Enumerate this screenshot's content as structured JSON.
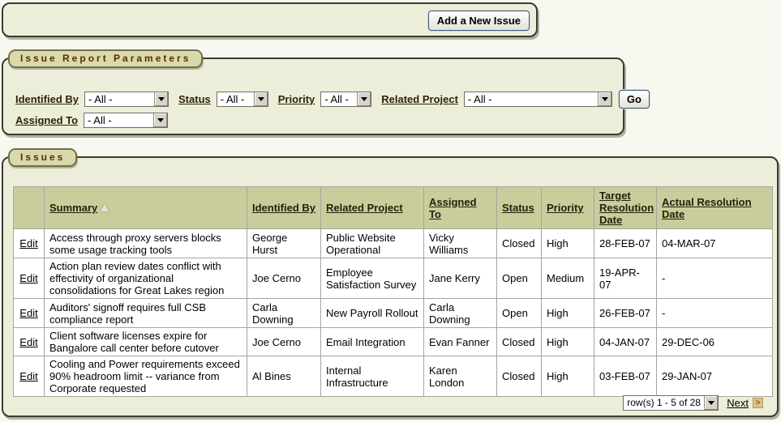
{
  "colors": {
    "page_bg": "#f7f9f0",
    "region_bg": "#edeeda",
    "tab_bg": "#d9d9ab",
    "tab_text": "#5a2c04",
    "table_header_bg": "#cacc9c",
    "button_border": "#3c5a7d",
    "next_icon_bg": "#dcc188"
  },
  "toolbar": {
    "add_button": "Add a New Issue"
  },
  "parameters": {
    "title": "Issue Report Parameters",
    "fields": [
      {
        "label": "Identified By",
        "value": "- All -"
      },
      {
        "label": "Status",
        "value": "- All -"
      },
      {
        "label": "Priority",
        "value": "- All -"
      },
      {
        "label": "Related Project",
        "value": "- All -"
      },
      {
        "label": "Assigned To",
        "value": "- All -"
      }
    ],
    "go_button": "Go"
  },
  "issues": {
    "title": "Issues",
    "edit_label": "Edit",
    "columns": [
      "",
      "Summary",
      "Identified By",
      "Related Project",
      "Assigned To",
      "Status",
      "Priority",
      "Target Resolution Date",
      "Actual Resolution Date"
    ],
    "sorted_column": "Summary",
    "sort_direction": "asc",
    "rows": [
      {
        "summary": "Access through proxy servers blocks some usage tracking tools",
        "identified_by": "George Hurst",
        "related_project": "Public Website Operational",
        "assigned_to": "Vicky Williams",
        "status": "Closed",
        "priority": "High",
        "target": "28-FEB-07",
        "actual": "04-MAR-07"
      },
      {
        "summary": "Action plan review dates conflict with effectivity of organizational consolidations for Great Lakes region",
        "identified_by": "Joe Cerno",
        "related_project": "Employee Satisfaction Survey",
        "assigned_to": "Jane Kerry",
        "status": "Open",
        "priority": "Medium",
        "target": "19-APR-07",
        "actual": "-"
      },
      {
        "summary": "Auditors' signoff requires full CSB compliance report",
        "identified_by": "Carla Downing",
        "related_project": "New Payroll Rollout",
        "assigned_to": "Carla Downing",
        "status": "Open",
        "priority": "High",
        "target": "26-FEB-07",
        "actual": "-"
      },
      {
        "summary": "Client software licenses expire for Bangalore call center before cutover",
        "identified_by": "Joe Cerno",
        "related_project": "Email Integration",
        "assigned_to": "Evan Fanner",
        "status": "Closed",
        "priority": "High",
        "target": "04-JAN-07",
        "actual": "29-DEC-06"
      },
      {
        "summary": "Cooling and Power requirements exceed 90% headroom limit -- variance from Corporate requested",
        "identified_by": "Al Bines",
        "related_project": "Internal Infrastructure",
        "assigned_to": "Karen London",
        "status": "Closed",
        "priority": "High",
        "target": "03-FEB-07",
        "actual": "29-JAN-07"
      }
    ],
    "pagination": {
      "range": "row(s) 1 - 5 of 28",
      "next_label": "Next",
      "next_icon": ">"
    }
  }
}
